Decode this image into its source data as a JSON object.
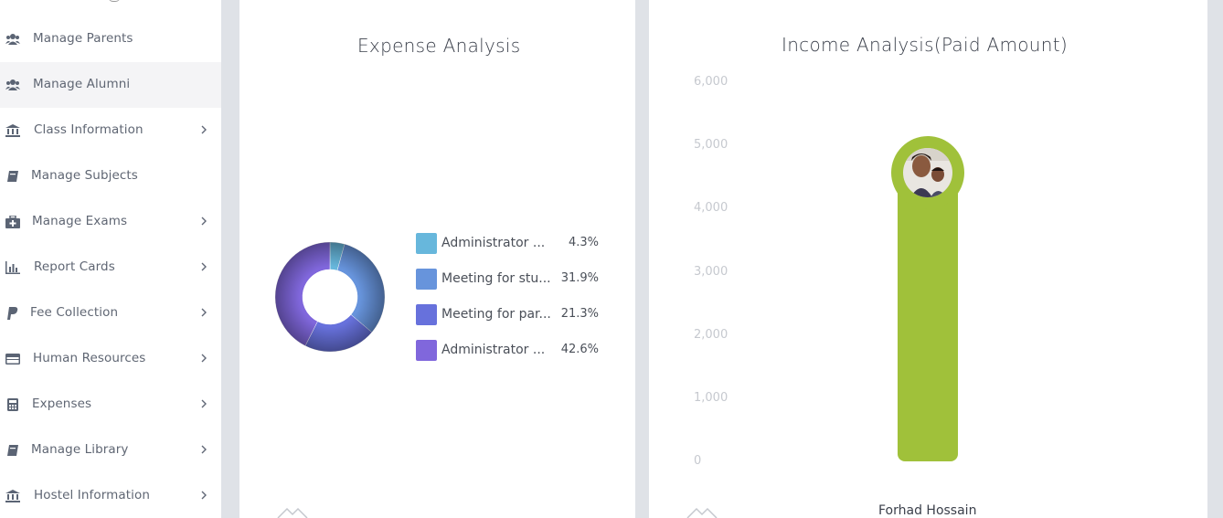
{
  "sidebar": {
    "items": [
      {
        "label": "Manage Parents",
        "icon": "users-icon",
        "has_submenu": false
      },
      {
        "label": "Manage Alumni",
        "icon": "users-icon",
        "has_submenu": false
      },
      {
        "label": "Class Information",
        "icon": "institution-icon",
        "has_submenu": true
      },
      {
        "label": "Manage Subjects",
        "icon": "book-icon",
        "has_submenu": false
      },
      {
        "label": "Manage Exams",
        "icon": "medkit-icon",
        "has_submenu": true
      },
      {
        "label": "Report Cards",
        "icon": "bar-chart-icon",
        "has_submenu": true
      },
      {
        "label": "Fee Collection",
        "icon": "paypal-icon",
        "has_submenu": true
      },
      {
        "label": "Human Resources",
        "icon": "credit-card-icon",
        "has_submenu": true
      },
      {
        "label": "Expenses",
        "icon": "calculator-icon",
        "has_submenu": true
      },
      {
        "label": "Manage Library",
        "icon": "book-icon",
        "has_submenu": true
      },
      {
        "label": "Hostel Information",
        "icon": "institution-icon",
        "has_submenu": true
      }
    ]
  },
  "expense_card": {
    "title": "Expense Analysis"
  },
  "income_card": {
    "title": "Income Analysis(Paid Amount)"
  },
  "chart_data": [
    {
      "type": "pie",
      "title": "Expense Analysis",
      "donut": true,
      "legend_position": "right",
      "slices": [
        {
          "label": "Administrator ...",
          "value": 4.3,
          "display": "4.3%",
          "color": "#67b7dc"
        },
        {
          "label": "Meeting for stu...",
          "value": 31.9,
          "display": "31.9%",
          "color": "#6794dc"
        },
        {
          "label": "Meeting for par...",
          "value": 21.3,
          "display": "21.3%",
          "color": "#6771dc"
        },
        {
          "label": "Administrator ...",
          "value": 42.6,
          "display": "42.6%",
          "color": "#8067dc"
        }
      ]
    },
    {
      "type": "bar",
      "title": "Income Analysis(Paid Amount)",
      "categories": [
        "Forhad Hossain"
      ],
      "values": [
        4700
      ],
      "ylim": [
        0,
        6000
      ],
      "yticks": [
        "6,000",
        "5,000",
        "4,000",
        "3,000",
        "2,000",
        "1,000",
        "0"
      ],
      "bar_color": "#a0c13a",
      "grid": false
    }
  ]
}
